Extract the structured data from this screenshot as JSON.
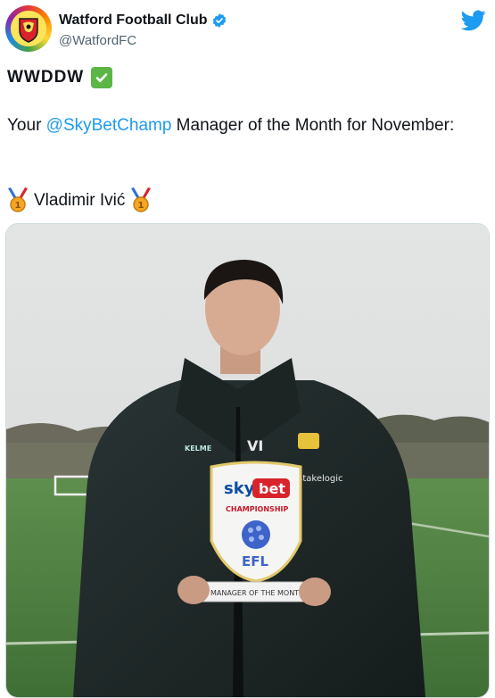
{
  "account": {
    "display_name": "Watford Football Club",
    "handle": "@WatfordFC",
    "verified": true,
    "avatar_icon": "watford-crest-rainbow"
  },
  "tweet": {
    "line1": "WWDDW",
    "line1_emoji": "check-mark-button",
    "line2_prefix": "Your ",
    "mention": "@SkyBetChamp",
    "line2_suffix": " Manager of the Month for November:",
    "line3_name": "Vladimir Ivić",
    "medal_emoji": "1st-place-medal"
  },
  "media": {
    "description_icon": "photo",
    "trophy": {
      "brand_sky": "sky",
      "brand_bet": "bet",
      "league": "CHAMPIONSHIP",
      "org": "EFL",
      "plaque": "MANAGER OF THE MONTH"
    },
    "jacket_brand": "KELME",
    "jacket_initials": "VI",
    "jacket_sponsor": "Stakelogic"
  },
  "colors": {
    "mention": "#1d9bf0",
    "verified": "#1d9bf0",
    "twitter": "#1d9bf0",
    "check": "#5bb646"
  }
}
